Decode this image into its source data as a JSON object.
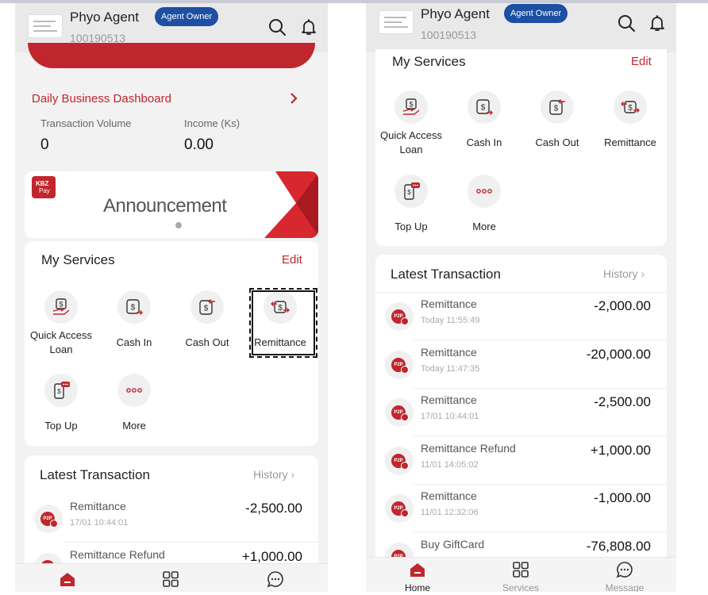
{
  "colors": {
    "brand_red": "#c0262d",
    "badge_blue": "#1d4fa2",
    "muted": "#999999"
  },
  "header": {
    "agent_name": "Phyo Agent",
    "agent_id": "100190513",
    "role_badge": "Agent Owner",
    "icons": [
      "search-icon",
      "bell-icon"
    ]
  },
  "left": {
    "dashboard": {
      "title": "Daily Business Dashboard",
      "volume_label": "Transaction Volume",
      "volume_value": "0",
      "income_label": "Income (Ks)",
      "income_value": "0.00"
    },
    "banner": {
      "logo_line1": "KBZ",
      "logo_line2": "Pay",
      "title": "Announcement"
    },
    "services": {
      "title": "My Services",
      "edit": "Edit",
      "items": [
        {
          "label_1": "Quick Access",
          "label_2": "Loan",
          "icon": "loan-hand-icon"
        },
        {
          "label_1": "Cash In",
          "label_2": "",
          "icon": "cash-in-icon"
        },
        {
          "label_1": "Cash Out",
          "label_2": "",
          "icon": "cash-out-icon"
        },
        {
          "label_1": "Remittance",
          "label_2": "",
          "icon": "remittance-icon"
        },
        {
          "label_1": "Top Up",
          "label_2": "",
          "icon": "top-up-icon"
        },
        {
          "label_1": "More",
          "label_2": "",
          "icon": "more-icon"
        }
      ]
    },
    "latest": {
      "title": "Latest Transaction",
      "history": "History",
      "transactions": [
        {
          "title": "Remittance",
          "time": "17/01 10:44:01",
          "amount": "-2,500.00"
        },
        {
          "title": "Remittance Refund",
          "time": "",
          "amount": "+1,000.00"
        }
      ]
    }
  },
  "right": {
    "services": {
      "title": "My Services",
      "edit": "Edit",
      "items": [
        {
          "label_1": "Quick Access",
          "label_2": "Loan",
          "icon": "loan-hand-icon"
        },
        {
          "label_1": "Cash In",
          "label_2": "",
          "icon": "cash-in-icon"
        },
        {
          "label_1": "Cash Out",
          "label_2": "",
          "icon": "cash-out-icon"
        },
        {
          "label_1": "Remittance",
          "label_2": "",
          "icon": "remittance-icon"
        },
        {
          "label_1": "Top Up",
          "label_2": "",
          "icon": "top-up-icon"
        },
        {
          "label_1": "More",
          "label_2": "",
          "icon": "more-icon"
        }
      ]
    },
    "latest": {
      "title": "Latest Transaction",
      "history": "History",
      "transactions": [
        {
          "title": "Remittance",
          "time": "Today 11:55:49",
          "amount": "-2,000.00"
        },
        {
          "title": "Remittance",
          "time": "Today 11:47:35",
          "amount": "-20,000.00"
        },
        {
          "title": "Remittance",
          "time": "17/01 10:44:01",
          "amount": "-2,500.00"
        },
        {
          "title": "Remittance Refund",
          "time": "11/01 14:05:02",
          "amount": "+1,000.00"
        },
        {
          "title": "Remittance",
          "time": "11/01 12:32:06",
          "amount": "-1,000.00"
        },
        {
          "title": "Buy GiftCard",
          "time": "",
          "amount": "-76,808.00"
        }
      ]
    },
    "tabbar": {
      "home": "Home",
      "services": "Services",
      "message": "Message"
    }
  },
  "p2p_badge": "P2P"
}
